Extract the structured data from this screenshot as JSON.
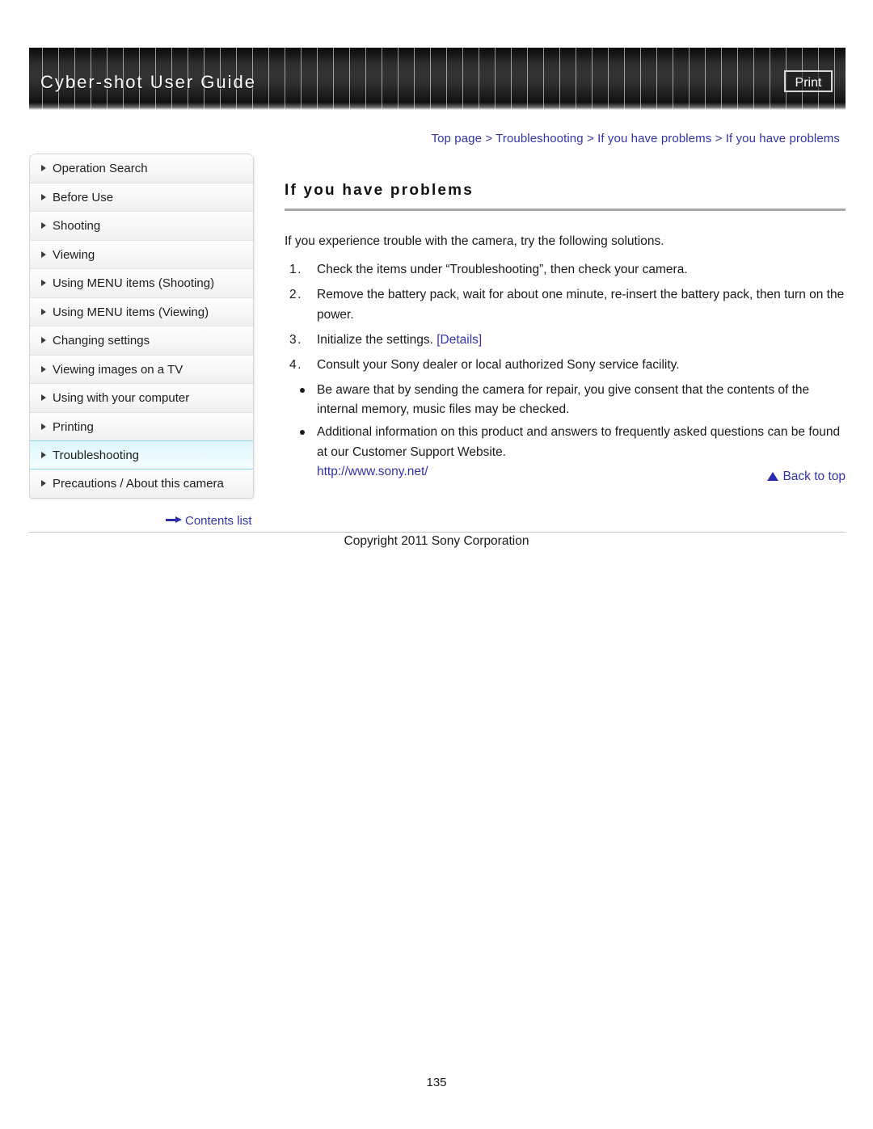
{
  "header": {
    "title": "Cyber-shot User Guide",
    "print_label": "Print"
  },
  "breadcrumb": {
    "items": [
      "Top page",
      "Troubleshooting",
      "If you have problems",
      "If you have problems"
    ],
    "separator": ">"
  },
  "sidebar": {
    "items": [
      {
        "label": "Operation Search",
        "active": false
      },
      {
        "label": "Before Use",
        "active": false
      },
      {
        "label": "Shooting",
        "active": false
      },
      {
        "label": "Viewing",
        "active": false
      },
      {
        "label": "Using MENU items (Shooting)",
        "active": false
      },
      {
        "label": "Using MENU items (Viewing)",
        "active": false
      },
      {
        "label": "Changing settings",
        "active": false
      },
      {
        "label": "Viewing images on a TV",
        "active": false
      },
      {
        "label": "Using with your computer",
        "active": false
      },
      {
        "label": "Printing",
        "active": false
      },
      {
        "label": "Troubleshooting",
        "active": true
      },
      {
        "label": "Precautions / About this camera",
        "active": false
      }
    ],
    "contents_list_label": "Contents list"
  },
  "main": {
    "title": "If you have problems",
    "intro": "If you experience trouble with the camera, try the following solutions.",
    "numbered_steps": [
      {
        "marker": "1.",
        "text": "Check the items under “Troubleshooting”, then check your camera.",
        "link": null
      },
      {
        "marker": "2.",
        "text": "Remove the battery pack, wait for about one minute, re-insert the battery pack, then turn on the power.",
        "link": null
      },
      {
        "marker": "3.",
        "text": "Initialize the settings.",
        "link": "[Details]"
      },
      {
        "marker": "4.",
        "text": "Consult your Sony dealer or local authorized Sony service facility.",
        "link": null
      }
    ],
    "bullets": [
      {
        "text": "Be aware that by sending the camera for repair, you give consent that the contents of the internal memory, music files may be checked.",
        "url": null
      },
      {
        "text": "Additional information on this product and answers to frequently asked questions can be found at our Customer Support Website.",
        "url": "http://www.sony.net/"
      }
    ],
    "back_to_top_label": "Back to top"
  },
  "footer": {
    "copyright": "Copyright 2011 Sony Corporation",
    "page_number": "135"
  },
  "colors": {
    "link": "#3333aa",
    "active_nav": "#ddf6fb",
    "rule": "#a8a8a8"
  }
}
